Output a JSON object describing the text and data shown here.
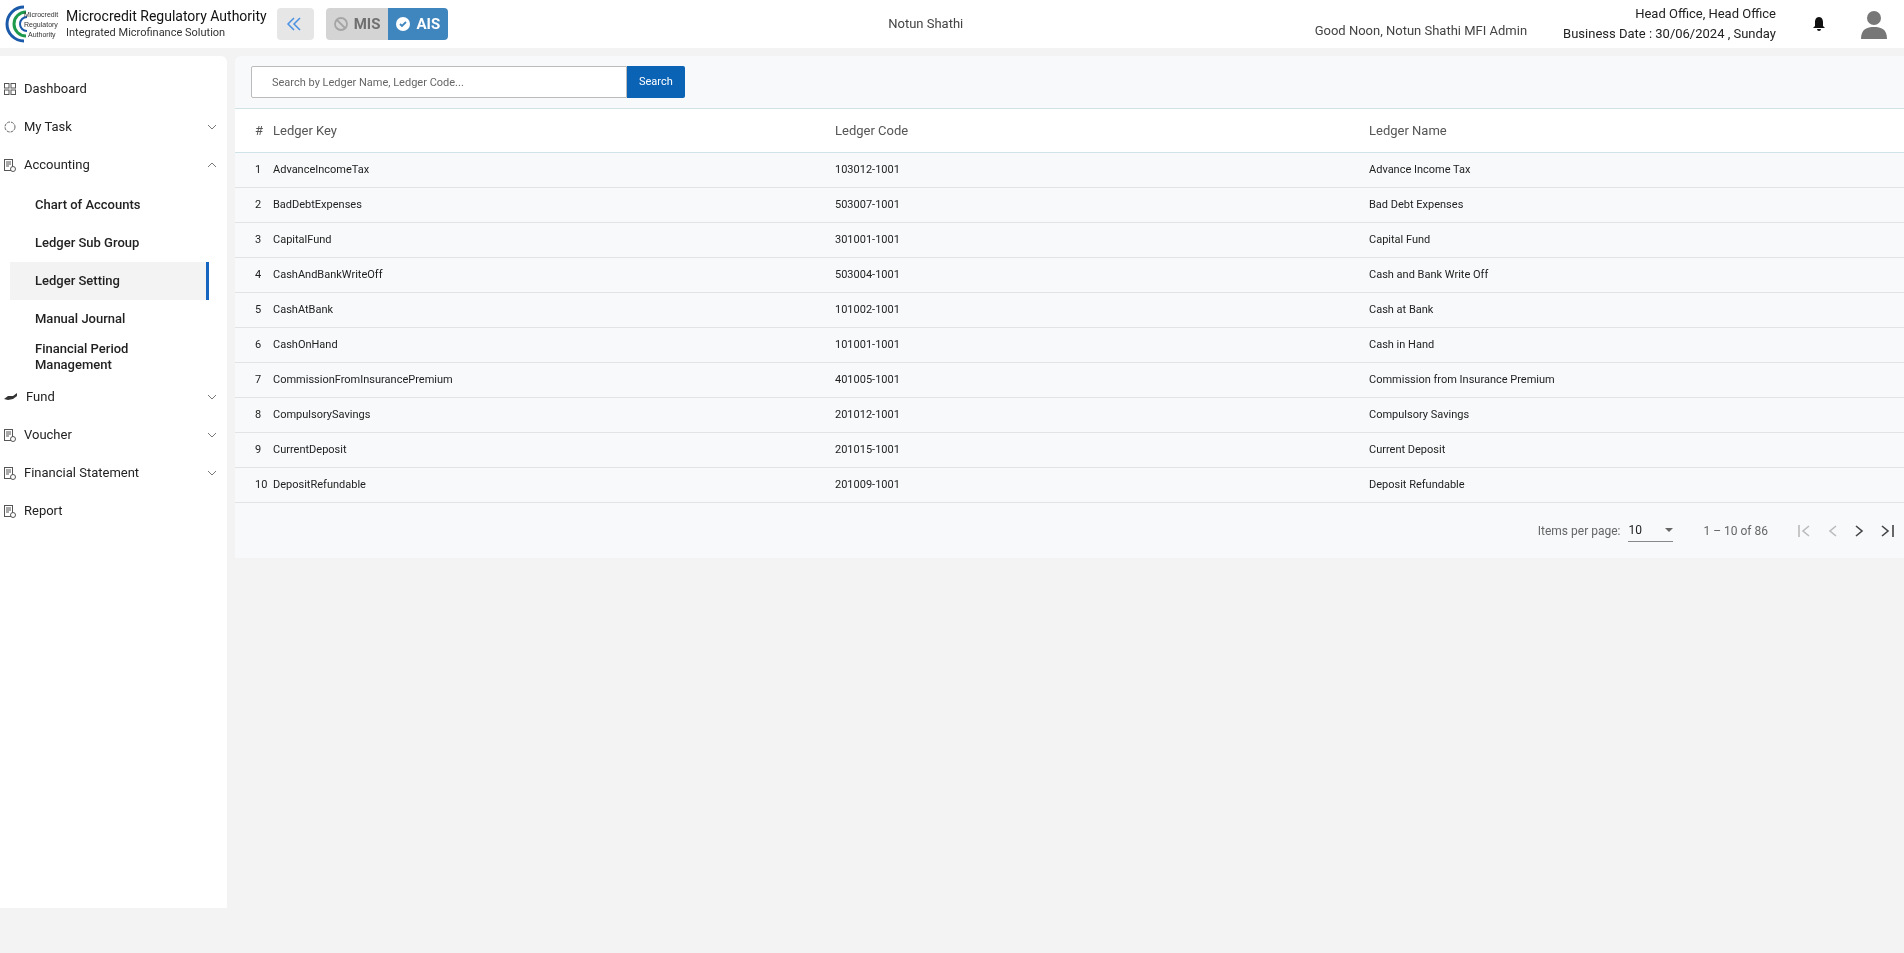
{
  "header": {
    "logo_text": [
      "Microcredit",
      "Regulatory",
      "Authority"
    ],
    "title": "Microcredit Regulatory Authority",
    "subtitle": "Integrated Microfinance Solution",
    "modes": [
      {
        "label": "MIS",
        "selected": false
      },
      {
        "label": "AIS",
        "selected": true
      }
    ],
    "org": "Notun Shathi",
    "greeting": "Good Noon, Notun Shathi MFI Admin",
    "office": "Head Office, Head Office",
    "business_date": "Business Date : 30/06/2024 , Sunday"
  },
  "sidebar": {
    "items": [
      {
        "label": "Dashboard"
      },
      {
        "label": "My Task",
        "expanded": false
      },
      {
        "label": "Accounting",
        "expanded": true,
        "children": [
          {
            "label": "Chart of Accounts",
            "selected": false
          },
          {
            "label": "Ledger Sub Group",
            "selected": false
          },
          {
            "label": "Ledger Setting",
            "selected": true
          },
          {
            "label": "Manual Journal",
            "selected": false
          },
          {
            "label": "Financial Period Management",
            "selected": false
          }
        ]
      },
      {
        "label": "Fund",
        "expanded": false
      },
      {
        "label": "Voucher",
        "expanded": false
      },
      {
        "label": "Financial Statement",
        "expanded": false
      },
      {
        "label": "Report"
      }
    ]
  },
  "search": {
    "placeholder": "Search by Ledger Name, Ledger Code...",
    "button": "Search"
  },
  "table": {
    "columns": [
      "#",
      "Ledger Key",
      "Ledger Code",
      "Ledger Name"
    ],
    "rows": [
      [
        "1",
        "AdvanceIncomeTax",
        "103012-1001",
        "Advance Income Tax"
      ],
      [
        "2",
        "BadDebtExpenses",
        "503007-1001",
        "Bad Debt Expenses"
      ],
      [
        "3",
        "CapitalFund",
        "301001-1001",
        "Capital Fund"
      ],
      [
        "4",
        "CashAndBankWriteOff",
        "503004-1001",
        "Cash and Bank Write Off"
      ],
      [
        "5",
        "CashAtBank",
        "101002-1001",
        "Cash at Bank"
      ],
      [
        "6",
        "CashOnHand",
        "101001-1001",
        "Cash in Hand"
      ],
      [
        "7",
        "CommissionFromInsurancePremium",
        "401005-1001",
        "Commission from Insurance Premium"
      ],
      [
        "8",
        "CompulsorySavings",
        "201012-1001",
        "Compulsory Savings"
      ],
      [
        "9",
        "CurrentDeposit",
        "201015-1001",
        "Current Deposit"
      ],
      [
        "10",
        "DepositRefundable",
        "201009-1001",
        "Deposit Refundable"
      ]
    ]
  },
  "paginator": {
    "label": "Items per page:",
    "page_size": "10",
    "range": "1 – 10 of 86"
  }
}
